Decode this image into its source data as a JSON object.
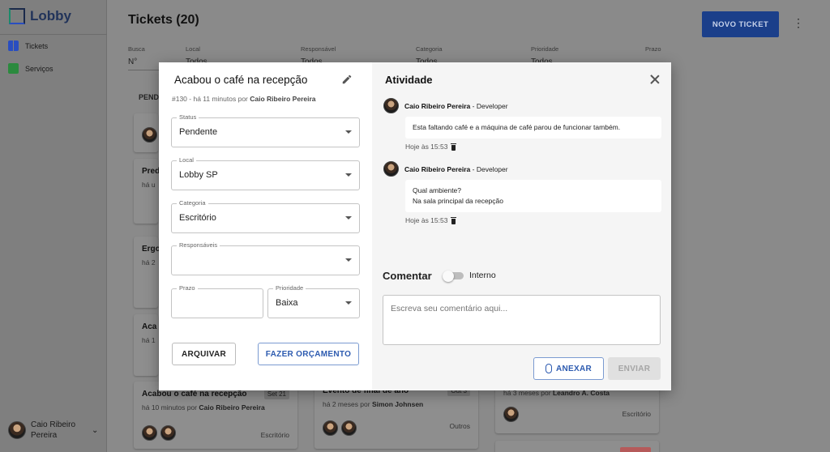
{
  "app": {
    "name": "Lobby"
  },
  "sidebar": {
    "items": [
      {
        "label": "Tickets",
        "icon": "tickets-icon"
      },
      {
        "label": "Serviços",
        "icon": "calendar-icon"
      }
    ],
    "user": {
      "name_line1": "Caio Ribeiro",
      "name_line2": "Pereira"
    }
  },
  "header": {
    "title": "Tickets (20)",
    "new_button": "NOVO TICKET"
  },
  "filters": [
    {
      "label": "Busca",
      "value": "N°"
    },
    {
      "label": "Local",
      "value": "Todos"
    },
    {
      "label": "Responsável",
      "value": "Todos"
    },
    {
      "label": "Categoria",
      "value": "Todos"
    },
    {
      "label": "Prioridade",
      "value": "Todos"
    },
    {
      "label": "Prazo",
      "value": ""
    }
  ],
  "board": {
    "column_label": "PEND",
    "cards": [
      {
        "title": "Pred",
        "sub": "há u"
      },
      {
        "title": "Ergo",
        "sub": "há 2"
      },
      {
        "title": "Aca",
        "sub": "há 1"
      },
      {
        "title": "Acabou o café na recepção",
        "date": "Set 21",
        "sub_prefix": "há 10 minutos por",
        "sub_author": "Caio Ribeiro Pereira",
        "category": "Escritório"
      },
      {
        "title": "Evento de final de ano",
        "date": "Out 3",
        "sub_prefix": "há 2 meses por",
        "sub_author": "Simon Johnsen",
        "category": "Outros"
      },
      {
        "sub_prefix": "há 3 meses por",
        "sub_author": "Leandro A. Costa",
        "category": "Escritório"
      }
    ]
  },
  "ticket": {
    "title": "Acabou o café na recepção",
    "meta_prefix": "#130 - há 11 minutos por",
    "meta_author": "Caio Ribeiro Pereira",
    "status": {
      "label": "Status",
      "value": "Pendente"
    },
    "local": {
      "label": "Local",
      "value": "Lobby SP"
    },
    "categoria": {
      "label": "Categoria",
      "value": "Escritório"
    },
    "responsaveis": {
      "label": "Responsáveis",
      "value": ""
    },
    "prazo": {
      "label": "Prazo",
      "value": ""
    },
    "prioridade": {
      "label": "Prioridade",
      "value": "Baixa"
    },
    "archive_button": "ARQUIVAR",
    "budget_button": "FAZER ORÇAMENTO"
  },
  "activity": {
    "title": "Atividade",
    "comments": [
      {
        "author": "Caio Ribeiro Pereira",
        "role": "- Developer",
        "lines": [
          "Esta faltando café e a máquina de café parou de funcionar também."
        ],
        "time": "Hoje às 15:53"
      },
      {
        "author": "Caio Ribeiro Pereira",
        "role": "- Developer",
        "lines": [
          "Qual ambiente?",
          "Na sala principal da recepção"
        ],
        "time": "Hoje às 15:53"
      }
    ],
    "comment_label": "Comentar",
    "internal_label": "Interno",
    "internal_on": false,
    "placeholder": "Escreva seu comentário aqui...",
    "attach_button": "ANEXAR",
    "send_button": "ENVIAR"
  },
  "colors": {
    "primary": "#1b3f8a",
    "accent": "#2d5bb0",
    "overlay": "#8a8a8a"
  }
}
